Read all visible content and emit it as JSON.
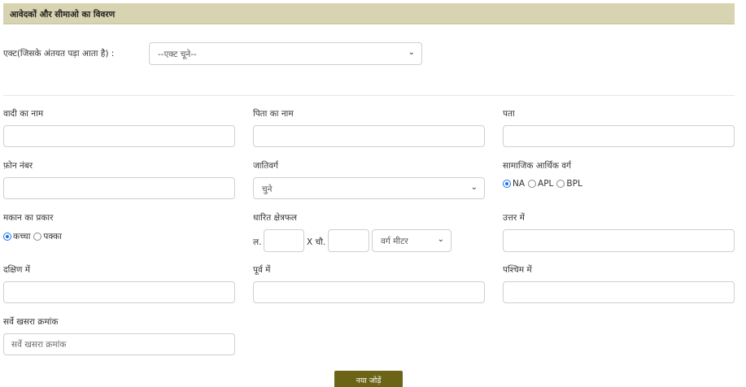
{
  "section": {
    "title": "आवेदकों और सीमाओ का विवरण"
  },
  "act": {
    "label": "एक्ट(जिसके अंतयत पड़ा आता है) :",
    "selected": "--एक्ट चूने--"
  },
  "fields": {
    "plaintiff_name": {
      "label": "वादी का नाम",
      "value": ""
    },
    "father_name": {
      "label": "पिता का नाम",
      "value": ""
    },
    "address": {
      "label": "पता",
      "value": ""
    },
    "phone": {
      "label": "फ़ोन नंबर",
      "value": ""
    },
    "caste": {
      "label": "जातिवर्ग",
      "selected": "चुने"
    },
    "socio_economic": {
      "label": "सामाजिक आर्थिक वर्ग",
      "options": [
        "NA",
        "APL",
        "BPL"
      ],
      "selected": "NA"
    },
    "house_type": {
      "label": "मकान का प्रकार",
      "options": [
        "कच्चा",
        "पक्का"
      ],
      "selected": "कच्चा"
    },
    "area": {
      "label": "धारित क्षेत्रफल",
      "length_prefix": "ल.",
      "width_prefix": "X चौ.",
      "unit": "वर्ग मीटर"
    },
    "north": {
      "label": "उत्तर में",
      "value": ""
    },
    "south": {
      "label": "दक्षिण में",
      "value": ""
    },
    "east": {
      "label": "पूर्व में",
      "value": ""
    },
    "west": {
      "label": "पश्चिम में",
      "value": ""
    },
    "survey_no": {
      "label": "सर्वे खसरा क्रमांक",
      "placeholder": "सर्वे खसरा क्रमांक"
    }
  },
  "actions": {
    "add_new": "नया जोड़ें"
  },
  "icons": {
    "dropdown": "chevron-down-icon"
  }
}
